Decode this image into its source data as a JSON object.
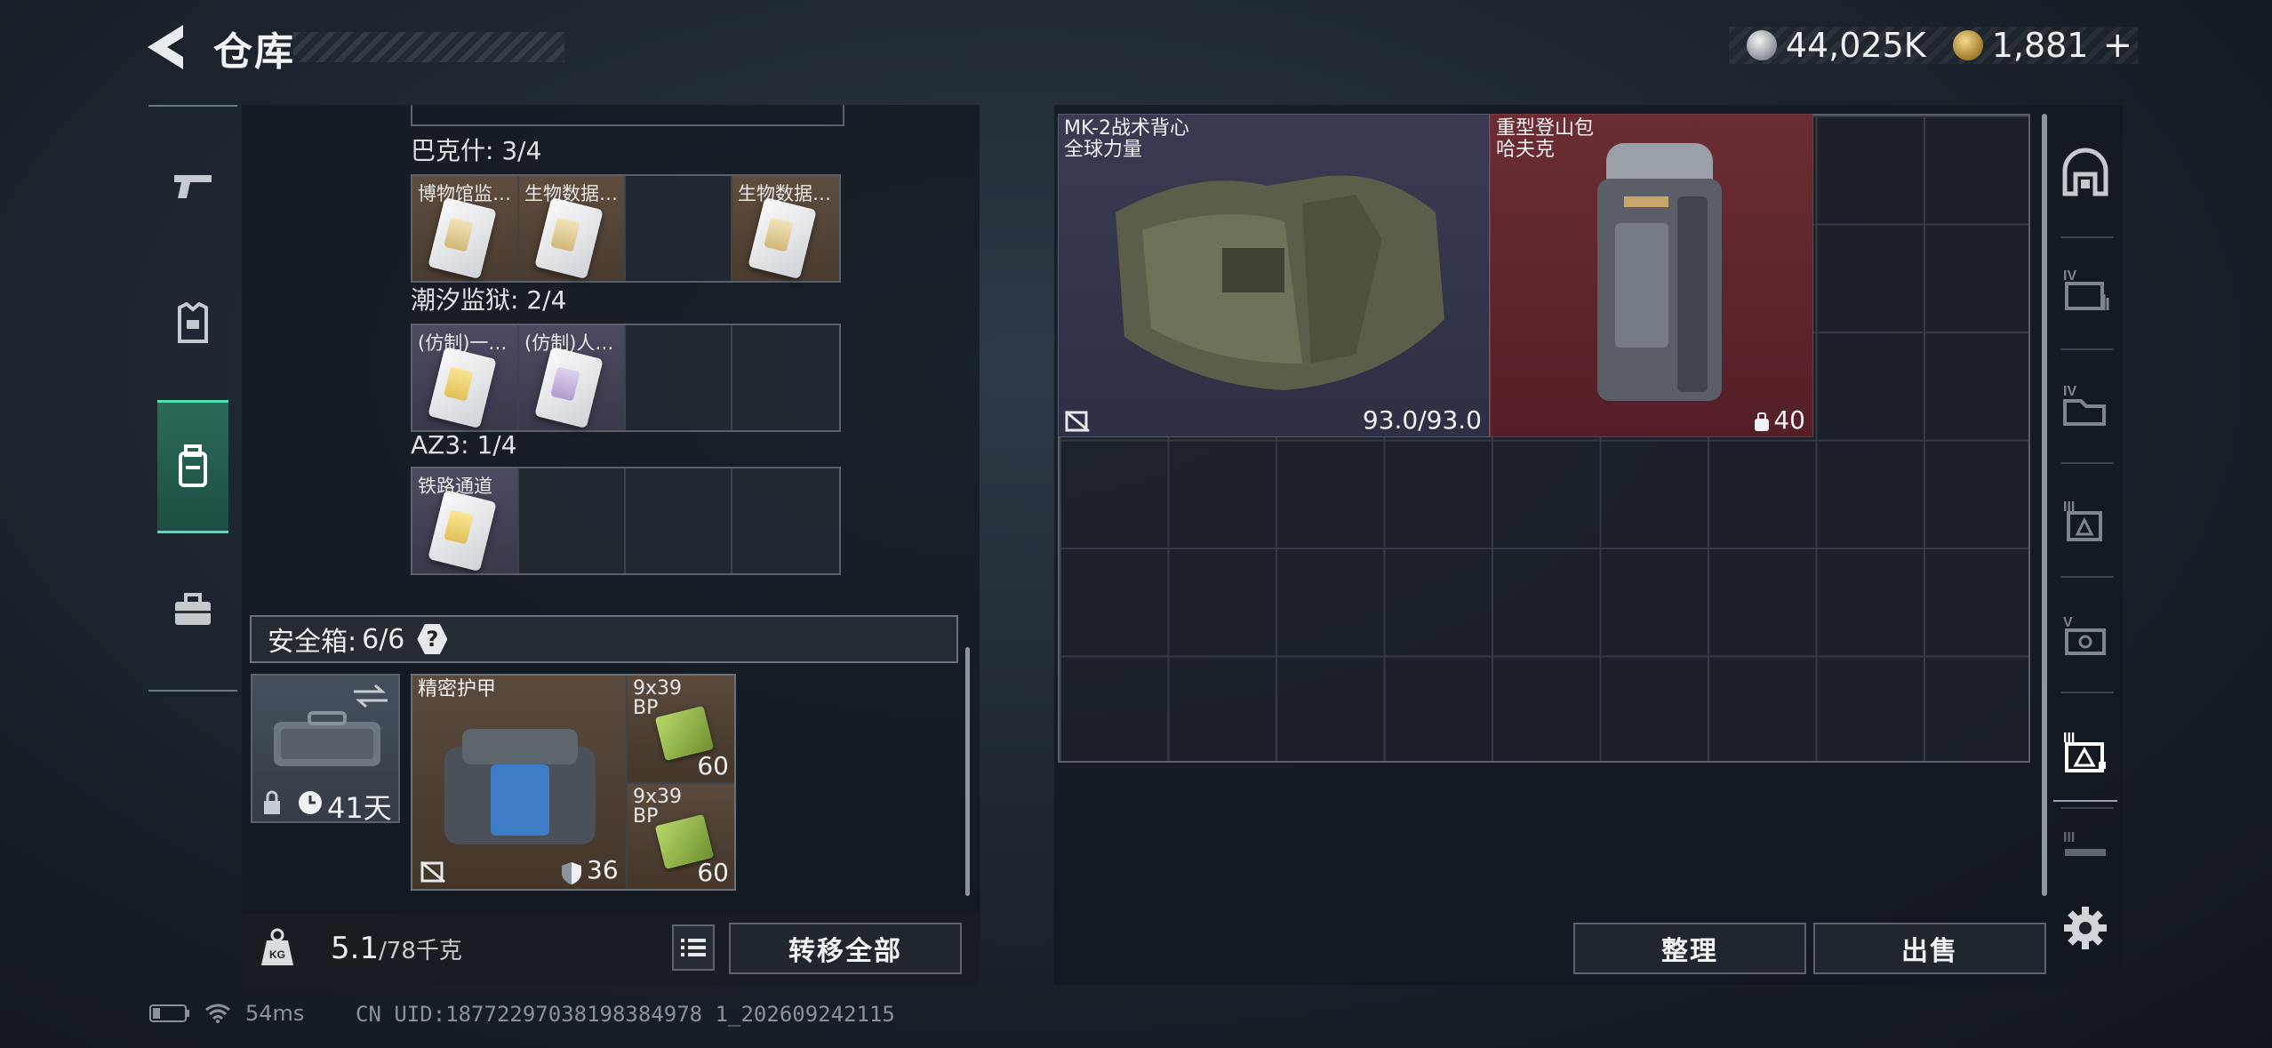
{
  "header": {
    "title": "仓库",
    "currency_silver": "44,025K",
    "currency_gold": "1,881",
    "currency_gold_plus": "+"
  },
  "safe_box_groups": [
    {
      "label": "巴克什: 3/4",
      "slots": [
        "博物馆监…",
        "生物数据…",
        "",
        "生物数据…"
      ]
    },
    {
      "label": "潮汐监狱: 2/4",
      "slots": [
        "(仿制)一…",
        "(仿制)人…",
        "",
        ""
      ]
    },
    {
      "label": "AZ3: 1/4",
      "slots": [
        "铁路通道",
        "",
        "",
        ""
      ]
    }
  ],
  "secure_container": {
    "label": "安全箱:",
    "count": "6/6",
    "help": "?",
    "days_left": "41天",
    "armor_name": "精密护甲",
    "armor_value": "36",
    "ammo": [
      {
        "name_line1": "9x39",
        "name_line2": "BP",
        "count": "60"
      },
      {
        "name_line1": "9x39",
        "name_line2": "BP",
        "count": "60"
      }
    ]
  },
  "footer": {
    "weight_current": "5.1",
    "weight_max": "/78千克",
    "transfer_all": "转移全部",
    "organize": "整理",
    "sell": "出售"
  },
  "stash_items": {
    "vest": {
      "line1": "MK-2战术背心",
      "line2": "全球力量",
      "durability": "93.0/93.0"
    },
    "backpack": {
      "line1": "重型登山包",
      "line2": "哈夫克",
      "capacity": "40"
    }
  },
  "status_bar": {
    "ping": "54ms",
    "uid": "CN UID:18772297038198384978 1_202609242115"
  },
  "colors": {
    "accent_green": "#4fe0b3",
    "vest_bg": "#34354c",
    "backpack_bg": "#5e262e"
  }
}
